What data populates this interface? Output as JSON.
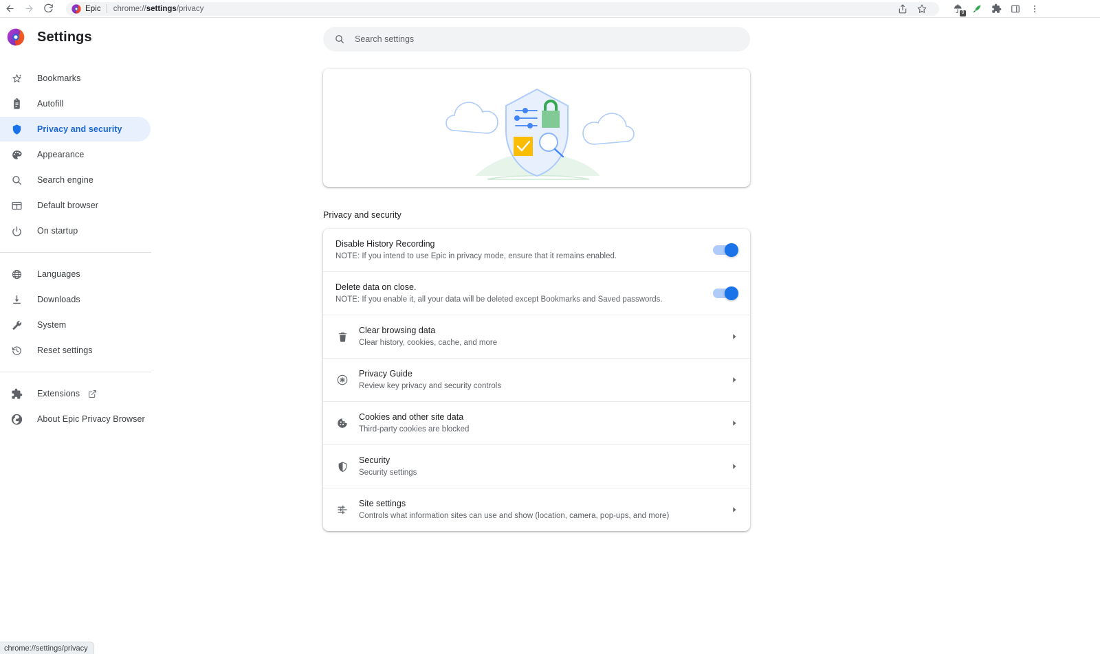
{
  "browser": {
    "back_icon": "back-arrow-icon",
    "forward_icon": "forward-arrow-icon",
    "reload_icon": "reload-icon",
    "brand": "Epic",
    "url_prefix": "chrome://",
    "url_bold": "settings",
    "url_suffix": "/privacy",
    "full_url": "chrome://settings/privacy",
    "actions": [
      {
        "name": "share-icon",
        "label": "Share"
      },
      {
        "name": "bookmark-star-icon",
        "label": "Bookmark this tab"
      },
      {
        "name": "umbrella-tracker-blocker-icon",
        "label": "Trackers blocked",
        "badge": "0"
      },
      {
        "name": "epic-proxy-icon",
        "label": "Proxy"
      },
      {
        "name": "extensions-puzzle-icon",
        "label": "Extensions"
      },
      {
        "name": "side-panel-icon",
        "label": "Side panel"
      },
      {
        "name": "more-menu-icon",
        "label": "Customize and control"
      }
    ]
  },
  "sidebar": {
    "title": "Settings",
    "logo": "epic-logo-icon",
    "groups": [
      {
        "items": [
          {
            "icon": "bookmarks-star-icon",
            "label": "Bookmarks",
            "active": false
          },
          {
            "icon": "autofill-clipboard-icon",
            "label": "Autofill",
            "active": false
          },
          {
            "icon": "shield-icon",
            "label": "Privacy and security",
            "active": true
          },
          {
            "icon": "palette-icon",
            "label": "Appearance",
            "active": false
          },
          {
            "icon": "search-magnifier-icon",
            "label": "Search engine",
            "active": false
          },
          {
            "icon": "browser-window-icon",
            "label": "Default browser",
            "active": false
          },
          {
            "icon": "power-icon",
            "label": "On startup",
            "active": false
          }
        ]
      },
      {
        "items": [
          {
            "icon": "globe-icon",
            "label": "Languages",
            "active": false
          },
          {
            "icon": "download-icon",
            "label": "Downloads",
            "active": false
          },
          {
            "icon": "wrench-icon",
            "label": "System",
            "active": false
          },
          {
            "icon": "history-restore-icon",
            "label": "Reset settings",
            "active": false
          }
        ]
      },
      {
        "items": [
          {
            "icon": "extensions-puzzle-icon",
            "label": "Extensions",
            "active": false,
            "external": true
          },
          {
            "icon": "epic-logo-icon",
            "label": "About Epic Privacy Browser",
            "active": false
          }
        ]
      }
    ]
  },
  "search": {
    "icon": "search-magnifier-icon",
    "placeholder": "Search settings",
    "value": ""
  },
  "hero": {
    "name": "privacy-shield-illustration",
    "colors": {
      "shield_fill": "#d7e3fc",
      "shield_stroke": "#aecbfa",
      "lock_green": "#81c995",
      "check_yellow": "#fbbc04",
      "cloud_stroke": "#aecbfa",
      "hill_green": "#ceead6"
    }
  },
  "main": {
    "section_title": "Privacy and security",
    "toggle_rows": [
      {
        "title": "Disable History Recording",
        "subtitle": "NOTE: If you intend to use Epic in privacy mode, ensure that it remains enabled.",
        "toggle_name": "disable-history-recording-toggle",
        "on": true
      },
      {
        "title": "Delete data on close.",
        "subtitle": "NOTE: If you enable it, all your data will be deleted except Bookmarks and Saved passwords.",
        "toggle_name": "delete-data-on-close-toggle",
        "on": true
      }
    ],
    "link_rows": [
      {
        "icon": "trash-delete-icon",
        "title": "Clear browsing data",
        "subtitle": "Clear history, cookies, cache, and more",
        "row_name": "clear-browsing-data-row"
      },
      {
        "icon": "privacy-guide-icon",
        "title": "Privacy Guide",
        "subtitle": "Review key privacy and security controls",
        "row_name": "privacy-guide-row"
      },
      {
        "icon": "cookie-icon",
        "title": "Cookies and other site data",
        "subtitle": "Third-party cookies are blocked",
        "row_name": "cookies-and-site-data-row"
      },
      {
        "icon": "shield-icon",
        "title": "Security",
        "subtitle": "Security settings",
        "row_name": "security-row"
      },
      {
        "icon": "tune-sliders-icon",
        "title": "Site settings",
        "subtitle": "Controls what information sites can use and show (location, camera, pop-ups, and more)",
        "row_name": "site-settings-row"
      }
    ]
  },
  "status_bar": {
    "text": "chrome://settings/privacy"
  },
  "theme": {
    "accent": "#1a73e8",
    "accent_light": "#aecbfa",
    "active_pill": "#e8f0fe",
    "text_primary": "#202124",
    "text_secondary": "#5f6368",
    "divider": "#e8eaed",
    "field_bg": "#f1f3f4"
  }
}
